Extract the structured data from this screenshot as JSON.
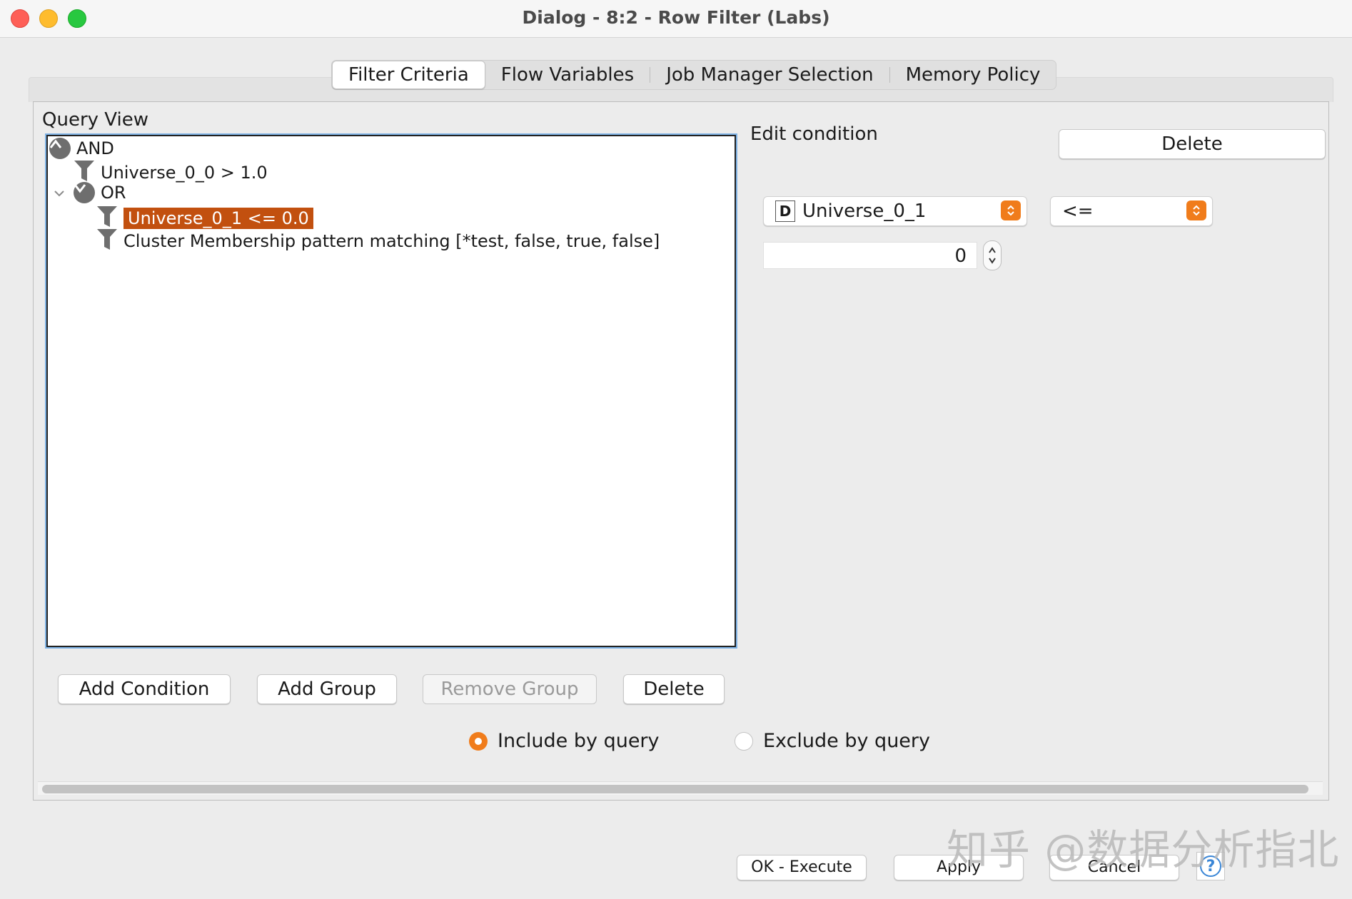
{
  "window": {
    "title": "Dialog - 8:2 - Row Filter (Labs)"
  },
  "tabs": [
    {
      "label": "Filter Criteria",
      "active": true
    },
    {
      "label": "Flow Variables",
      "active": false
    },
    {
      "label": "Job Manager Selection",
      "active": false
    },
    {
      "label": "Memory Policy",
      "active": false
    }
  ],
  "query_view": {
    "label": "Query View",
    "tree": {
      "and_label": "AND",
      "cond1": "Universe_0_0 > 1.0",
      "or_label": "OR",
      "cond2_selected": "Universe_0_1 <= 0.0",
      "cond3": "Cluster Membership pattern matching [*test, false, true, false]"
    },
    "buttons": {
      "add_condition": "Add Condition",
      "add_group": "Add Group",
      "remove_group": "Remove Group",
      "delete": "Delete"
    }
  },
  "edit_condition": {
    "label": "Edit condition",
    "delete_label": "Delete",
    "column_type_badge": "D",
    "column": "Universe_0_1",
    "operator": "<=",
    "value": "0"
  },
  "mode": {
    "include_label": "Include by query",
    "exclude_label": "Exclude by query",
    "selected": "include"
  },
  "footer": {
    "ok_execute": "OK - Execute",
    "apply": "Apply",
    "cancel": "Cancel",
    "help_glyph": "?"
  },
  "watermark": "知乎 @数据分析指北",
  "colors": {
    "accent": "#f07c1b",
    "selection": "#c2500f",
    "focus_outline": "#7fb3e6"
  },
  "icons": [
    "close-light",
    "minimize-light",
    "zoom-light",
    "and-group-icon",
    "or-group-icon",
    "filter-icon",
    "chevron-down-icon",
    "stepper-icon",
    "help-icon"
  ]
}
